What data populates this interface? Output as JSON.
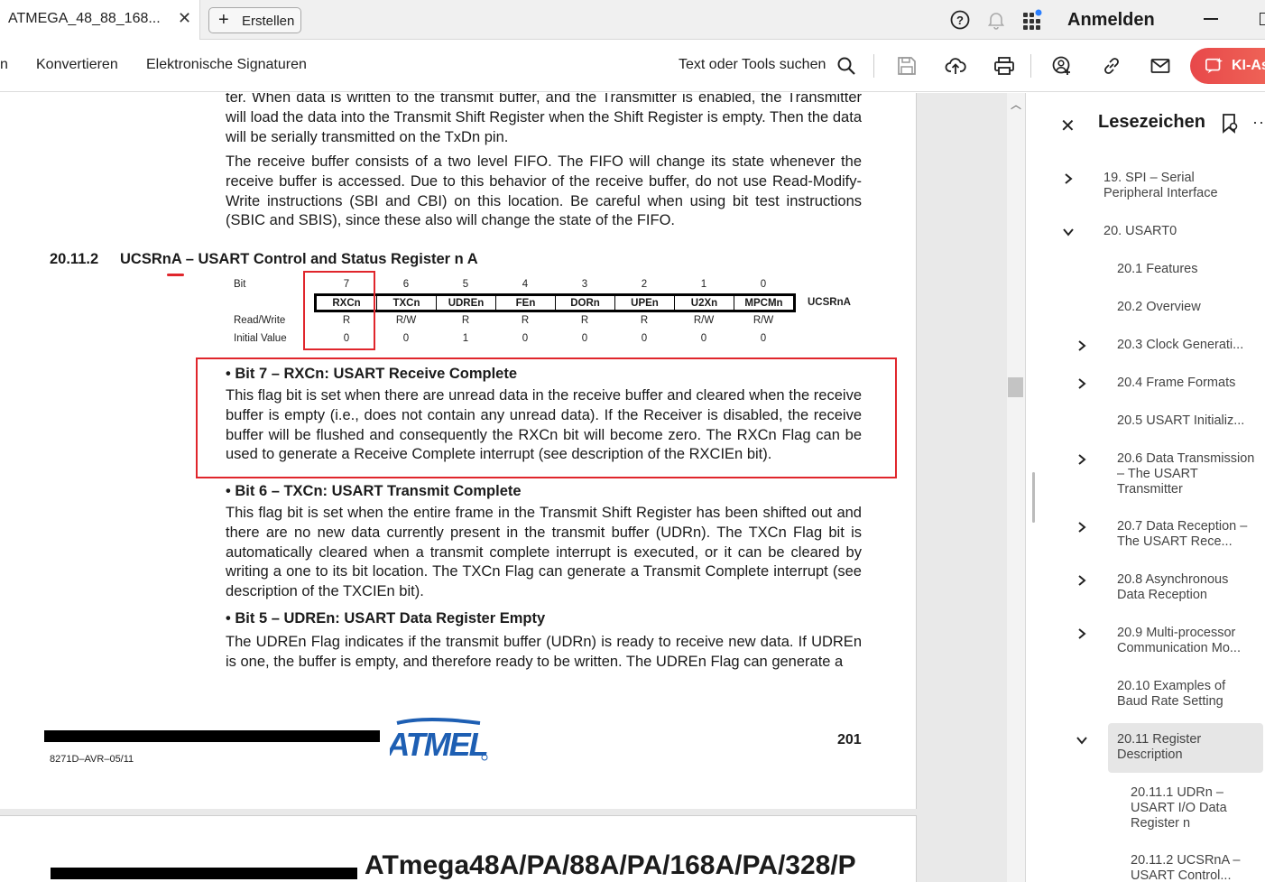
{
  "tabbar": {
    "tab_title": "ATMEGA_48_88_168...",
    "create_label": "Erstellen",
    "signin_label": "Anmelden"
  },
  "toolbar": {
    "menu": [
      "n",
      "Konvertieren",
      "Elektronische Signaturen"
    ],
    "search_label": "Text oder Tools suchen",
    "ai_label": "KI-As"
  },
  "document": {
    "para1": "ter. When data is written to the transmit buffer, and the Transmitter is enabled, the Transmitter will load the data into the Transmit Shift Register when the Shift Register is empty. Then the data will be serially transmitted on the TxDn pin.",
    "para2": "The receive buffer consists of a two level FIFO. The FIFO will change its state whenever the receive buffer is accessed. Due to this behavior of the receive buffer, do not use Read-Modify-Write instructions (SBI and CBI) on this location. Be careful when using bit test instructions (SBIC and SBIS), since these also will change the state of the FIFO.",
    "section_number": "20.11.2",
    "section_title": "UCSRnA – USART Control and Status Register n A",
    "register": {
      "bit_label": "Bit",
      "rw_label": "Read/Write",
      "init_label": "Initial Value",
      "name": "UCSRnA",
      "bits": [
        "7",
        "6",
        "5",
        "4",
        "3",
        "2",
        "1",
        "0"
      ],
      "fields": [
        "RXCn",
        "TXCn",
        "UDREn",
        "FEn",
        "DORn",
        "UPEn",
        "U2Xn",
        "MPCMn"
      ],
      "access": [
        "R",
        "R/W",
        "R",
        "R",
        "R",
        "R",
        "R/W",
        "R/W"
      ],
      "initial": [
        "0",
        "0",
        "1",
        "0",
        "0",
        "0",
        "0",
        "0"
      ]
    },
    "bit7_title": "•  Bit 7 – RXCn: USART Receive Complete",
    "bit7_text": "This flag bit is set when there are unread data in the receive buffer and cleared when the receive buffer is empty (i.e., does not contain any unread data). If the Receiver is disabled, the receive buffer will be flushed and consequently the RXCn bit will become zero. The RXCn Flag can be used to generate a Receive Complete interrupt (see description of the RXCIEn bit).",
    "bit6_title": "•  Bit 6 – TXCn: USART Transmit Complete",
    "bit6_text": "This flag bit is set when the entire frame in the Transmit Shift Register has been shifted out and there are no new data currently present in the transmit buffer (UDRn). The TXCn Flag bit is automatically cleared when a transmit complete interrupt is executed, or it can be cleared by writing a one to its bit location. The TXCn Flag can generate a Transmit Complete interrupt (see description of the TXCIEn bit).",
    "bit5_title": "•  Bit 5 – UDREn: USART Data Register Empty",
    "bit5_text": "The UDREn Flag indicates if the transmit buffer (UDRn) is ready to receive new data. If UDREn is one, the buffer is empty, and therefore ready to be written. The UDREn Flag can generate a",
    "footer_code": "8271D–AVR–05/11",
    "page_number": "201",
    "logo_text": "ATMEL",
    "next_page_header": "ATmega48A/PA/88A/PA/168A/PA/328/P"
  },
  "bookmarks": {
    "title": "Lesezeichen",
    "items": [
      {
        "label": "19. SPI – Serial Peripheral Interface",
        "chevron": "right"
      },
      {
        "label": "20. USART0",
        "chevron": "down"
      },
      {
        "label": "20.1 Features",
        "chevron": ""
      },
      {
        "label": "20.2 Overview",
        "chevron": ""
      },
      {
        "label": "20.3 Clock Generati...",
        "chevron": "right"
      },
      {
        "label": "20.4 Frame Formats",
        "chevron": "right"
      },
      {
        "label": "20.5 USART Initializ...",
        "chevron": ""
      },
      {
        "label": "20.6 Data Transmission – The USART Transmitter",
        "chevron": "right"
      },
      {
        "label": "20.7 Data Reception – The USART Rece...",
        "chevron": "right"
      },
      {
        "label": "20.8 Asynchronous Data Reception",
        "chevron": "right"
      },
      {
        "label": "20.9 Multi-processor Communication Mo...",
        "chevron": "right"
      },
      {
        "label": "20.10 Examples of Baud Rate Setting",
        "chevron": ""
      },
      {
        "label": "20.11 Register Description",
        "chevron": "down"
      },
      {
        "label": "20.11.1 UDRn – USART I/O Data Register n",
        "chevron": ""
      },
      {
        "label": "20.11.2 UCSRnA – USART Control...",
        "chevron": ""
      }
    ]
  },
  "colors": {
    "highlight_red": "#e0262c",
    "ai_button": "#e8484a",
    "atmel_blue": "#1e5fb3"
  }
}
